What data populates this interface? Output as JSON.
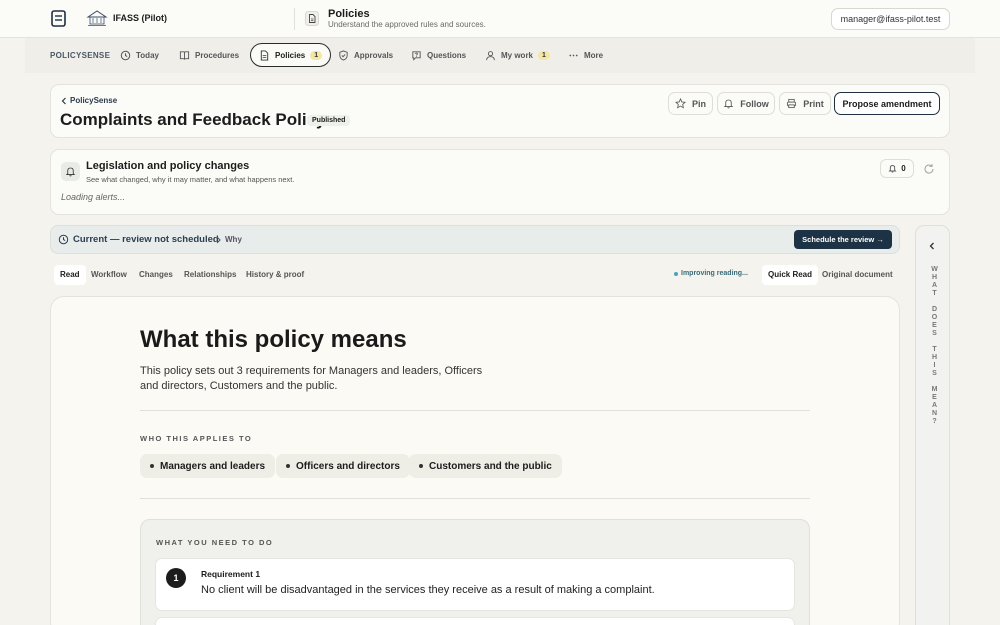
{
  "header": {
    "org_name": "IFASS (Pilot)",
    "page_title": "Policies",
    "page_subtitle": "Understand the approved rules and sources.",
    "user_email": "manager@ifass-pilot.test"
  },
  "nav": {
    "brand": "POLICYSENSE",
    "items": [
      {
        "label": "Today",
        "icon": "clock-icon"
      },
      {
        "label": "Procedures",
        "icon": "book-icon"
      },
      {
        "label": "Policies",
        "icon": "document-icon",
        "badge": "1",
        "active": true
      },
      {
        "label": "Approvals",
        "icon": "shield-check-icon"
      },
      {
        "label": "Questions",
        "icon": "question-icon"
      },
      {
        "label": "My work",
        "icon": "user-icon",
        "badge": "1"
      },
      {
        "label": "More",
        "icon": "more-icon"
      }
    ]
  },
  "policy": {
    "breadcrumb": "PolicySense",
    "title": "Complaints and Feedback Policy",
    "status": "Published",
    "actions": {
      "pin": "Pin",
      "follow": "Follow",
      "print": "Print",
      "propose": "Propose amendment"
    }
  },
  "alerts": {
    "title": "Legislation and policy changes",
    "subtitle": "See what changed, why it may matter, and what happens next.",
    "count": "0",
    "loading": "Loading alerts..."
  },
  "review": {
    "status": "Current — review not scheduled",
    "why": "Why",
    "schedule_button": "Schedule the review →"
  },
  "tabs": {
    "items": [
      "Read",
      "Workflow",
      "Changes",
      "Relationships",
      "History & proof"
    ],
    "active": "Read",
    "improving": "Improving reading...",
    "modes": [
      "Quick Read",
      "Original document"
    ],
    "active_mode": "Quick Read"
  },
  "content": {
    "title": "What this policy means",
    "summary": "This policy sets out 3 requirements for Managers and leaders, Officers and directors, Customers and the public.",
    "applies_label": "WHO THIS APPLIES TO",
    "audiences": [
      "Managers and leaders",
      "Officers and directors",
      "Customers and the public"
    ],
    "todo_label": "WHAT YOU NEED TO DO",
    "requirements": [
      {
        "number": "1",
        "label": "Requirement 1",
        "text": "No client will be disadvantaged in the services they receive as a result of making a complaint."
      }
    ]
  },
  "side_panel": {
    "label": "WHAT DOES THIS MEAN?"
  }
}
